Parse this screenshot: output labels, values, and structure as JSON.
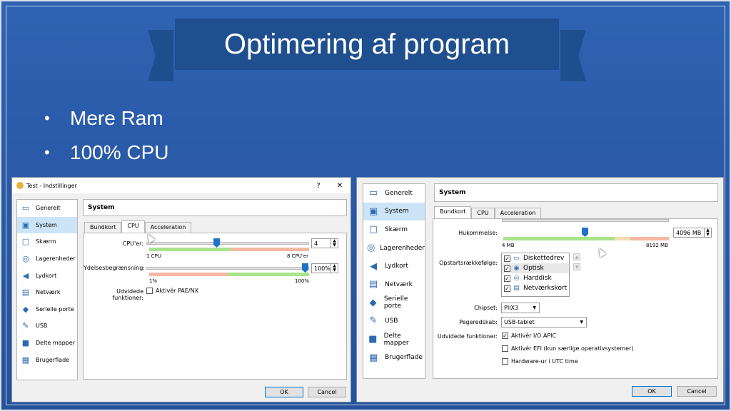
{
  "slide": {
    "title": "Optimering af program",
    "bullets": [
      "Mere Ram",
      "100% CPU"
    ],
    "bullet_glyph": "•"
  },
  "win1": {
    "title": "Test - Indstillinger",
    "help": "?",
    "close": "✕",
    "sidebar": [
      "Generelt",
      "System",
      "Skærm",
      "Lagerenheder",
      "Lydkort",
      "Netværk",
      "Serielle porte",
      "USB",
      "Delte mapper",
      "Brugerflade"
    ],
    "panel_title": "System",
    "tabs": [
      "Bundkort",
      "CPU",
      "Acceleration"
    ],
    "cpu_label": "CPU'er:",
    "cpu_value": "4",
    "cpu_min": "1 CPU",
    "cpu_max": "8 CPU'er",
    "cap_label": "Ydelsesbegrænsning:",
    "cap_value": "100%",
    "cap_min": "1%",
    "cap_max": "100%",
    "ext_label": "Udvidede funktioner:",
    "pae_label": "Aktivér PAE/NX",
    "ok": "OK",
    "cancel": "Cancel"
  },
  "win2": {
    "sidebar": [
      "Generelt",
      "System",
      "Skærm",
      "Lagerenheder",
      "Lydkort",
      "Netværk",
      "Serielle porte",
      "USB",
      "Delte mapper",
      "Brugerflade"
    ],
    "panel_title": "System",
    "tabs": [
      "Bundkort",
      "CPU",
      "Acceleration"
    ],
    "mem_label": "Hukommelse:",
    "mem_value": "4096 MB",
    "mem_min": "4 MB",
    "mem_max": "8192 MB",
    "boot_label": "Opstartsrækkefølge:",
    "boot_items": [
      "Diskettedrev",
      "Optisk",
      "Harddisk",
      "Netværkskort"
    ],
    "chipset_label": "Chipset:",
    "chipset_value": "PIIX3",
    "pointing_label": "Pegeredskab:",
    "pointing_value": "USB-tablet",
    "ext_label": "Udvidede funktioner:",
    "ioapic_label": "Aktivér I/O APIC",
    "efi_label": "Aktivér EFI (kun særlige operativsystemer)",
    "utc_label": "Hardware-ur i UTC time",
    "ok": "OK",
    "cancel": "Cancel"
  }
}
